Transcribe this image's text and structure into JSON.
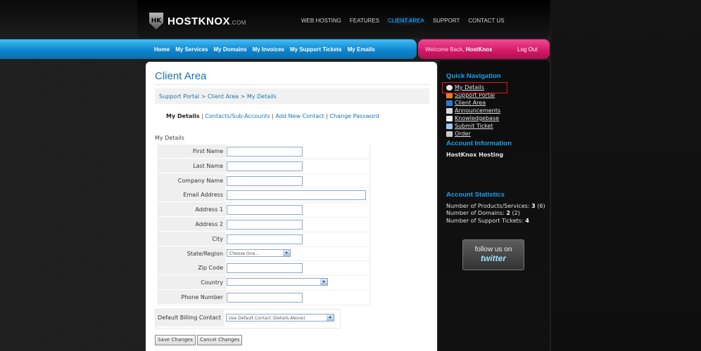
{
  "brand": {
    "logo_mark": "HK",
    "name": "HOSTKNOX",
    "tld": ".COM"
  },
  "topnav": [
    "WEB HOSTING",
    "FEATURES",
    "CLIENT AREA",
    "SUPPORT",
    "CONTACT US"
  ],
  "mainnav": [
    "Home",
    "My Services",
    "My Domains",
    "My Invoices",
    "My Support Tickets",
    "My Emails"
  ],
  "user": {
    "welcome_prefix": "Welcome Back,",
    "name": "HostKnox",
    "logout": "Log Out"
  },
  "page": {
    "title": "Client Area",
    "breadcrumb": "Support Portal > Client Area > My Details",
    "subnav": {
      "current": "My Details",
      "links": [
        "Contacts/Sub-Accounts",
        "Add New Contact",
        "Change Password"
      ],
      "separator": "|"
    },
    "section_label": "My Details"
  },
  "form": {
    "fields": [
      {
        "label": "First Name",
        "value": ""
      },
      {
        "label": "Last Name",
        "value": ""
      },
      {
        "label": "Company Name",
        "value": ""
      },
      {
        "label": "Email Address",
        "value": ""
      },
      {
        "label": "Address 1",
        "value": ""
      },
      {
        "label": "Address 2",
        "value": ""
      },
      {
        "label": "City",
        "value": ""
      },
      {
        "label": "State/Region",
        "value": "Choose One..."
      },
      {
        "label": "Zip Code",
        "value": ""
      },
      {
        "label": "Country",
        "value": ""
      },
      {
        "label": "Phone Number",
        "value": ""
      }
    ],
    "billing": {
      "label": "Default Billing Contact",
      "value": "Use Default Contact (Details Above)"
    },
    "save_label": "Save Changes",
    "cancel_label": "Cancel Changes"
  },
  "sidebar": {
    "quick_nav_title": "Quick Navigation",
    "links": [
      {
        "label": "My Details",
        "icon": "info-icon",
        "color": "#e8e8e8"
      },
      {
        "label": "Support Portal",
        "icon": "home-icon",
        "color": "#e67e22"
      },
      {
        "label": "Client Area",
        "icon": "client-icon",
        "color": "#2a7ad8"
      },
      {
        "label": "Announcements",
        "icon": "announcements-icon",
        "color": "#d9d9d9"
      },
      {
        "label": "Knowledgebase",
        "icon": "book-icon",
        "color": "#f0f0f0"
      },
      {
        "label": "Submit Ticket",
        "icon": "ticket-icon",
        "color": "#9ec8f0"
      },
      {
        "label": "Order",
        "icon": "cart-icon",
        "color": "#cccccc"
      }
    ],
    "account_info_title": "Account Information",
    "account_name": "HostKnox Hosting",
    "stats_title": "Account Statistics",
    "stats": [
      {
        "label": "Number of Products/Services:",
        "value": "3",
        "extra": "(6)"
      },
      {
        "label": "Number of Domains:",
        "value": "2",
        "extra": "(2)"
      },
      {
        "label": "Number of Support Tickets:",
        "value": "4",
        "extra": ""
      }
    ],
    "twitter": {
      "line1": "follow us on",
      "line2": "twitter"
    }
  }
}
